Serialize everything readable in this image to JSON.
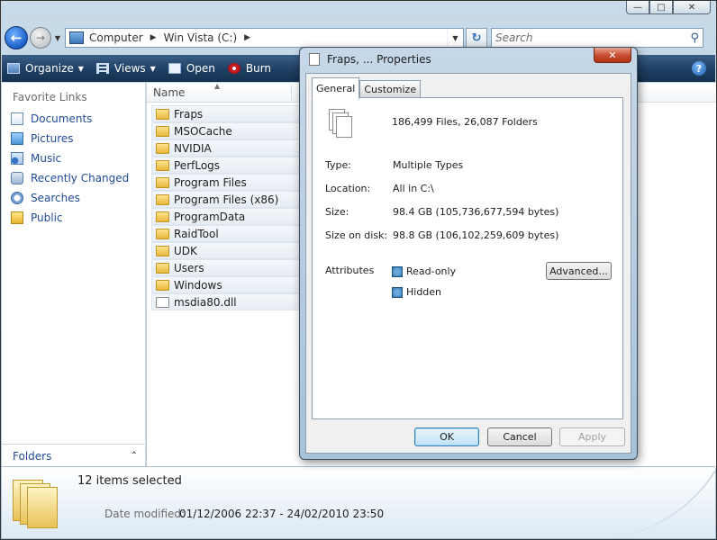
{
  "address": {
    "crumbs": [
      "Computer",
      "Win Vista (C:)"
    ]
  },
  "search": {
    "placeholder": "Search"
  },
  "toolbar": {
    "organize": "Organize",
    "views": "Views",
    "open": "Open",
    "burn": "Burn",
    "help": "?"
  },
  "nav_pane": {
    "heading": "Favorite Links",
    "links": [
      "Documents",
      "Pictures",
      "Music",
      "Recently Changed",
      "Searches",
      "Public"
    ],
    "folders_label": "Folders"
  },
  "file_list": {
    "column_name": "Name",
    "items": [
      {
        "name": "Fraps",
        "type": "folder"
      },
      {
        "name": "MSOCache",
        "type": "folder"
      },
      {
        "name": "NVIDIA",
        "type": "folder"
      },
      {
        "name": "PerfLogs",
        "type": "folder"
      },
      {
        "name": "Program Files",
        "type": "folder"
      },
      {
        "name": "Program Files (x86)",
        "type": "folder"
      },
      {
        "name": "ProgramData",
        "type": "folder"
      },
      {
        "name": "RaidTool",
        "type": "folder"
      },
      {
        "name": "UDK",
        "type": "folder"
      },
      {
        "name": "Users",
        "type": "folder"
      },
      {
        "name": "Windows",
        "type": "folder"
      },
      {
        "name": "msdia80.dll",
        "type": "file"
      }
    ]
  },
  "details": {
    "selected_count": "12 items selected",
    "date_modified_label": "Date modified:",
    "date_modified_value": "01/12/2006 22:37 - 24/02/2010 23:50"
  },
  "dialog": {
    "title": "Fraps, ... Properties",
    "tabs": [
      "General",
      "Customize"
    ],
    "summary": "186,499 Files, 26,087 Folders",
    "type_label": "Type:",
    "type_value": "Multiple Types",
    "location_label": "Location:",
    "location_value": "All in C:\\",
    "size_label": "Size:",
    "size_value": "98.4 GB (105,736,677,594 bytes)",
    "size_on_disk_label": "Size on disk:",
    "size_on_disk_value": "98.8 GB (106,102,259,609 bytes)",
    "attributes_label": "Attributes",
    "readonly_label": "Read-only",
    "hidden_label": "Hidden",
    "advanced_label": "Advanced...",
    "ok_label": "OK",
    "cancel_label": "Cancel",
    "apply_label": "Apply"
  }
}
